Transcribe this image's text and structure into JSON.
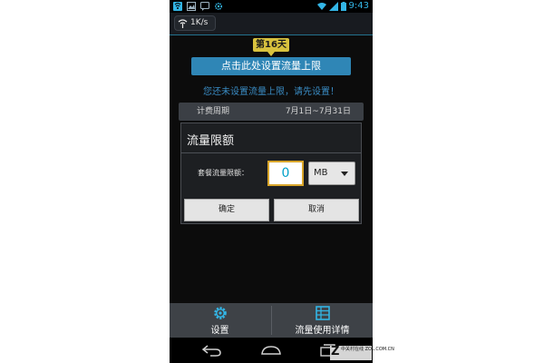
{
  "status_bar": {
    "time": "9:43",
    "icons": [
      "notification-icon",
      "image-icon",
      "chat-icon",
      "settings-gear-icon",
      "wifi-icon",
      "signal-icon",
      "battery-icon"
    ],
    "accent_color": "#33b5e5"
  },
  "speed_indicator": {
    "text": "1K/s",
    "icon": "speed-icon"
  },
  "day_badge": {
    "text": "第16天"
  },
  "set_limit_banner": {
    "text": "点击此处设置流量上限"
  },
  "hint_text": "您还未设置流量上限，请先设置！",
  "billing_period": {
    "label": "计费周期",
    "value": "7月1日~7月31日"
  },
  "dialog": {
    "title": "流量限额",
    "limit_label": "套餐流量限额：",
    "limit_value": "0",
    "unit": "MB",
    "ok_label": "确定",
    "cancel_label": "取消"
  },
  "bottom_tabs": [
    {
      "label": "设置",
      "icon": "gear-icon"
    },
    {
      "label": "流量使用详情",
      "icon": "list-icon"
    }
  ],
  "navigation": {
    "icons": [
      "back-icon",
      "home-icon",
      "recent-apps-icon"
    ]
  },
  "watermark": {
    "letter": "Z",
    "text": "中关村在线 ZOL.COM.CN"
  }
}
